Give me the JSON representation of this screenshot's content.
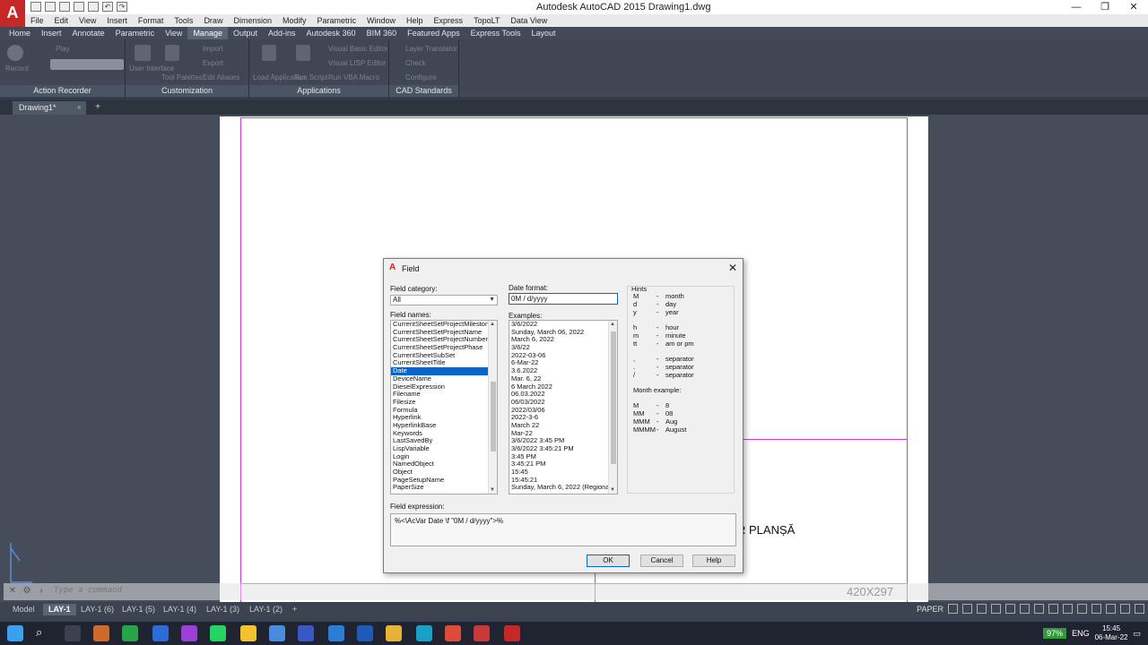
{
  "app": {
    "title": "Autodesk AutoCAD 2015   Drawing1.dwg",
    "logo": "A",
    "window_controls": [
      "—",
      "❐",
      "✕"
    ]
  },
  "menubar": [
    "File",
    "Edit",
    "View",
    "Insert",
    "Format",
    "Tools",
    "Draw",
    "Dimension",
    "Modify",
    "Parametric",
    "Window",
    "Help",
    "Express",
    "TopoLT",
    "Data View"
  ],
  "ribbon_tabs": [
    "Home",
    "Insert",
    "Annotate",
    "Parametric",
    "View",
    "Manage",
    "Output",
    "Add-ins",
    "Autodesk 360",
    "BIM 360",
    "Featured Apps",
    "Express Tools",
    "Layout"
  ],
  "ribbon_active_tab": "Manage",
  "ribbon_panels": {
    "action_recorder": "Action Recorder",
    "customization": "Customization",
    "applications": "Applications",
    "cad_standards": "CAD Standards",
    "faded_labels": [
      "Record",
      "Play",
      "User Interface",
      "Tool Palettes",
      "Import",
      "Export",
      "Edit Aliases",
      "Load Application",
      "Run Script",
      "Visual Basic Editor",
      "Visual LISP Editor",
      "Run VBA Macro",
      "Layer Translator",
      "Check",
      "Configure"
    ]
  },
  "file_tab": {
    "label": "Drawing1*",
    "close": "×",
    "add": "+"
  },
  "drawing": {
    "plansa_text": "R PLANȘĂ",
    "paper_size": "420X297"
  },
  "command_line": {
    "placeholder": "Type a command",
    "close": "✕"
  },
  "layout_tabs": [
    "Model",
    "LAY-1",
    "LAY-1 (6)",
    "LAY-1 (5)",
    "LAY-1 (4)",
    "LAY-1 (3)",
    "LAY-1 (2)",
    "+"
  ],
  "layout_active": "LAY-1",
  "status": {
    "paper": "PAPER"
  },
  "taskbar": {
    "battery": "97%",
    "lang": "ENG",
    "time": "15:45",
    "date": "06-Mar-22"
  },
  "dialog": {
    "title": "Field",
    "close": "✕",
    "field_category_label": "Field category:",
    "field_category_value": "All",
    "field_names_label": "Field names:",
    "field_names": [
      "CurrentSheetSetProjectMilestone",
      "CurrentSheetSetProjectName",
      "CurrentSheetSetProjectNumber",
      "CurrentSheetSetProjectPhase",
      "CurrentSheetSubSet",
      "CurrentSheetTitle",
      "Date",
      "DeviceName",
      "DieselExpression",
      "Filename",
      "Filesize",
      "Formula",
      "Hyperlink",
      "HyperlinkBase",
      "Keywords",
      "LastSavedBy",
      "LispVariable",
      "Login",
      "NamedObject",
      "Object",
      "PageSetupName",
      "PaperSize"
    ],
    "field_names_selected": "Date",
    "date_format_label": "Date format:",
    "date_format_value": "0M / d/yyyy",
    "examples_label": "Examples:",
    "examples": [
      "3/6/2022",
      "Sunday, March 06, 2022",
      "March 6, 2022",
      "3/6/22",
      "2022-03-06",
      "6-Mar-22",
      "3.6.2022",
      "Mar. 6, 22",
      "6 March 2022",
      "06.03.2022",
      "06/03/2022",
      "2022/03/06",
      "2022-3-6",
      "March 22",
      "Mar-22",
      "3/6/2022 3:45 PM",
      "3/6/2022 3:45:21 PM",
      "3:45 PM",
      "3:45:21 PM",
      "15:45",
      "15:45:21",
      "Sunday, March 6, 2022 (Regional"
    ],
    "hints_label": "Hints",
    "hints": [
      {
        "k": "M",
        "v": "month"
      },
      {
        "k": "d",
        "v": "day"
      },
      {
        "k": "y",
        "v": "year"
      },
      {
        "k": "h",
        "v": "hour"
      },
      {
        "k": "m",
        "v": "minute"
      },
      {
        "k": "tt",
        "v": "am or pm"
      },
      {
        "k": ",",
        "v": "separator"
      },
      {
        "k": ".",
        "v": "separator"
      },
      {
        "k": "/",
        "v": "separator"
      }
    ],
    "hint_dash": "-",
    "month_example_label": "Month example:",
    "month_examples": [
      {
        "k": "M",
        "v": "8"
      },
      {
        "k": "MM",
        "v": "08"
      },
      {
        "k": "MMM",
        "v": "Aug"
      },
      {
        "k": "MMMM",
        "v": "August"
      }
    ],
    "field_expression_label": "Field expression:",
    "field_expression": "%<\\AcVar Date \\f \"0M / d/yyyy\">%",
    "ok": "OK",
    "cancel": "Cancel",
    "help": "Help"
  }
}
